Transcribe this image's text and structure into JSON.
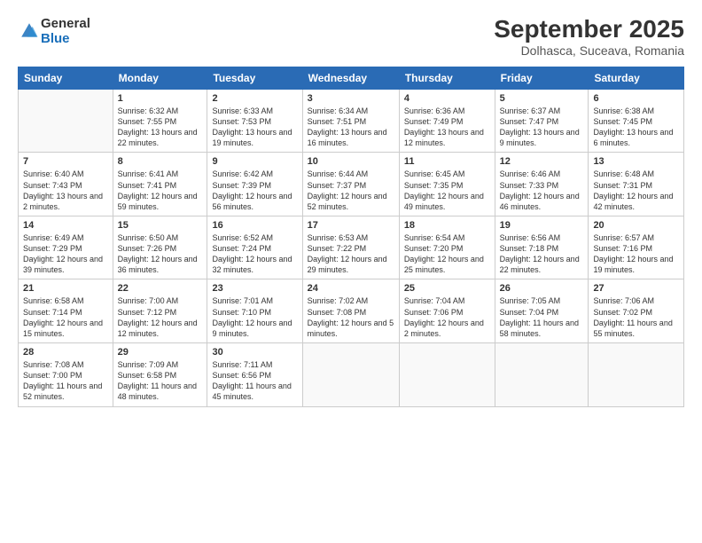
{
  "logo": {
    "general": "General",
    "blue": "Blue"
  },
  "title": "September 2025",
  "subtitle": "Dolhasca, Suceava, Romania",
  "days_of_week": [
    "Sunday",
    "Monday",
    "Tuesday",
    "Wednesday",
    "Thursday",
    "Friday",
    "Saturday"
  ],
  "weeks": [
    [
      {
        "num": "",
        "empty": true
      },
      {
        "num": "1",
        "sunrise": "Sunrise: 6:32 AM",
        "sunset": "Sunset: 7:55 PM",
        "daylight": "Daylight: 13 hours and 22 minutes."
      },
      {
        "num": "2",
        "sunrise": "Sunrise: 6:33 AM",
        "sunset": "Sunset: 7:53 PM",
        "daylight": "Daylight: 13 hours and 19 minutes."
      },
      {
        "num": "3",
        "sunrise": "Sunrise: 6:34 AM",
        "sunset": "Sunset: 7:51 PM",
        "daylight": "Daylight: 13 hours and 16 minutes."
      },
      {
        "num": "4",
        "sunrise": "Sunrise: 6:36 AM",
        "sunset": "Sunset: 7:49 PM",
        "daylight": "Daylight: 13 hours and 12 minutes."
      },
      {
        "num": "5",
        "sunrise": "Sunrise: 6:37 AM",
        "sunset": "Sunset: 7:47 PM",
        "daylight": "Daylight: 13 hours and 9 minutes."
      },
      {
        "num": "6",
        "sunrise": "Sunrise: 6:38 AM",
        "sunset": "Sunset: 7:45 PM",
        "daylight": "Daylight: 13 hours and 6 minutes."
      }
    ],
    [
      {
        "num": "7",
        "sunrise": "Sunrise: 6:40 AM",
        "sunset": "Sunset: 7:43 PM",
        "daylight": "Daylight: 13 hours and 2 minutes."
      },
      {
        "num": "8",
        "sunrise": "Sunrise: 6:41 AM",
        "sunset": "Sunset: 7:41 PM",
        "daylight": "Daylight: 12 hours and 59 minutes."
      },
      {
        "num": "9",
        "sunrise": "Sunrise: 6:42 AM",
        "sunset": "Sunset: 7:39 PM",
        "daylight": "Daylight: 12 hours and 56 minutes."
      },
      {
        "num": "10",
        "sunrise": "Sunrise: 6:44 AM",
        "sunset": "Sunset: 7:37 PM",
        "daylight": "Daylight: 12 hours and 52 minutes."
      },
      {
        "num": "11",
        "sunrise": "Sunrise: 6:45 AM",
        "sunset": "Sunset: 7:35 PM",
        "daylight": "Daylight: 12 hours and 49 minutes."
      },
      {
        "num": "12",
        "sunrise": "Sunrise: 6:46 AM",
        "sunset": "Sunset: 7:33 PM",
        "daylight": "Daylight: 12 hours and 46 minutes."
      },
      {
        "num": "13",
        "sunrise": "Sunrise: 6:48 AM",
        "sunset": "Sunset: 7:31 PM",
        "daylight": "Daylight: 12 hours and 42 minutes."
      }
    ],
    [
      {
        "num": "14",
        "sunrise": "Sunrise: 6:49 AM",
        "sunset": "Sunset: 7:29 PM",
        "daylight": "Daylight: 12 hours and 39 minutes."
      },
      {
        "num": "15",
        "sunrise": "Sunrise: 6:50 AM",
        "sunset": "Sunset: 7:26 PM",
        "daylight": "Daylight: 12 hours and 36 minutes."
      },
      {
        "num": "16",
        "sunrise": "Sunrise: 6:52 AM",
        "sunset": "Sunset: 7:24 PM",
        "daylight": "Daylight: 12 hours and 32 minutes."
      },
      {
        "num": "17",
        "sunrise": "Sunrise: 6:53 AM",
        "sunset": "Sunset: 7:22 PM",
        "daylight": "Daylight: 12 hours and 29 minutes."
      },
      {
        "num": "18",
        "sunrise": "Sunrise: 6:54 AM",
        "sunset": "Sunset: 7:20 PM",
        "daylight": "Daylight: 12 hours and 25 minutes."
      },
      {
        "num": "19",
        "sunrise": "Sunrise: 6:56 AM",
        "sunset": "Sunset: 7:18 PM",
        "daylight": "Daylight: 12 hours and 22 minutes."
      },
      {
        "num": "20",
        "sunrise": "Sunrise: 6:57 AM",
        "sunset": "Sunset: 7:16 PM",
        "daylight": "Daylight: 12 hours and 19 minutes."
      }
    ],
    [
      {
        "num": "21",
        "sunrise": "Sunrise: 6:58 AM",
        "sunset": "Sunset: 7:14 PM",
        "daylight": "Daylight: 12 hours and 15 minutes."
      },
      {
        "num": "22",
        "sunrise": "Sunrise: 7:00 AM",
        "sunset": "Sunset: 7:12 PM",
        "daylight": "Daylight: 12 hours and 12 minutes."
      },
      {
        "num": "23",
        "sunrise": "Sunrise: 7:01 AM",
        "sunset": "Sunset: 7:10 PM",
        "daylight": "Daylight: 12 hours and 9 minutes."
      },
      {
        "num": "24",
        "sunrise": "Sunrise: 7:02 AM",
        "sunset": "Sunset: 7:08 PM",
        "daylight": "Daylight: 12 hours and 5 minutes."
      },
      {
        "num": "25",
        "sunrise": "Sunrise: 7:04 AM",
        "sunset": "Sunset: 7:06 PM",
        "daylight": "Daylight: 12 hours and 2 minutes."
      },
      {
        "num": "26",
        "sunrise": "Sunrise: 7:05 AM",
        "sunset": "Sunset: 7:04 PM",
        "daylight": "Daylight: 11 hours and 58 minutes."
      },
      {
        "num": "27",
        "sunrise": "Sunrise: 7:06 AM",
        "sunset": "Sunset: 7:02 PM",
        "daylight": "Daylight: 11 hours and 55 minutes."
      }
    ],
    [
      {
        "num": "28",
        "sunrise": "Sunrise: 7:08 AM",
        "sunset": "Sunset: 7:00 PM",
        "daylight": "Daylight: 11 hours and 52 minutes."
      },
      {
        "num": "29",
        "sunrise": "Sunrise: 7:09 AM",
        "sunset": "Sunset: 6:58 PM",
        "daylight": "Daylight: 11 hours and 48 minutes."
      },
      {
        "num": "30",
        "sunrise": "Sunrise: 7:11 AM",
        "sunset": "Sunset: 6:56 PM",
        "daylight": "Daylight: 11 hours and 45 minutes."
      },
      {
        "num": "",
        "empty": true
      },
      {
        "num": "",
        "empty": true
      },
      {
        "num": "",
        "empty": true
      },
      {
        "num": "",
        "empty": true
      }
    ]
  ]
}
